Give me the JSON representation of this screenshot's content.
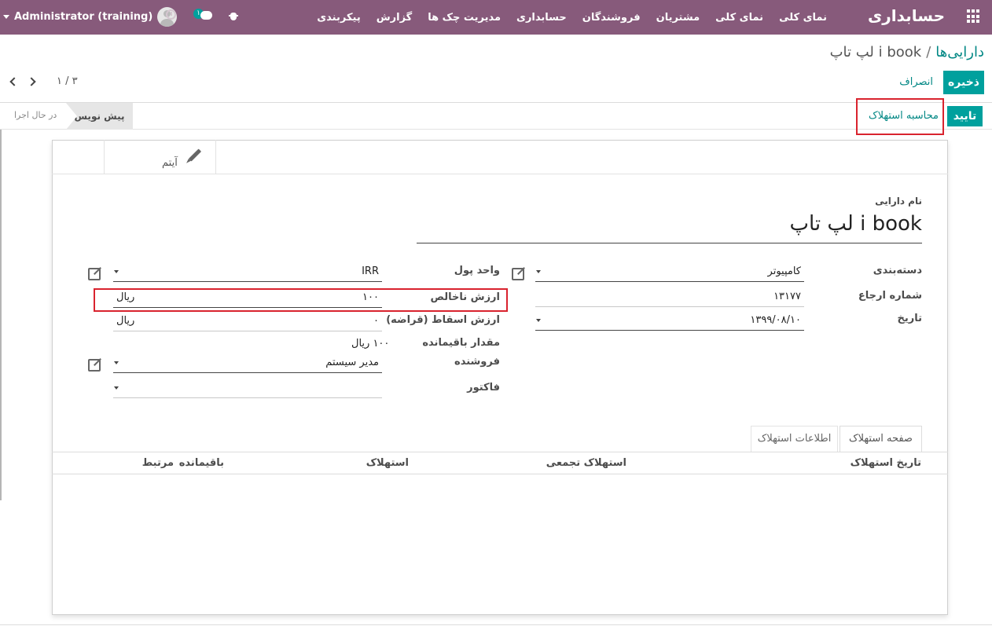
{
  "navbar": {
    "brand": "حسابداری",
    "menu": [
      "نمای کلی",
      "نمای کلی",
      "مشتریان",
      "فروشندگان",
      "حسابداری",
      "مدیریت چک ها",
      "گزارش",
      "پیکربندی"
    ],
    "user": "Administrator (training)",
    "chat_badge": "۱",
    "icons": [
      "apps-grid-icon",
      "clock-icon",
      "chat-icon",
      "bug-icon",
      "user-avatar",
      "chevron-down-icon"
    ]
  },
  "breadcrumb": {
    "parent": "دارایی‌ها",
    "separator": "/",
    "current": "i book لپ تاپ"
  },
  "buttons": {
    "save": "ذخیره",
    "discard": "انصراف",
    "confirm": "تایید",
    "compute": "محاسبه استهلاک"
  },
  "pager": {
    "value": "۱ / ۳"
  },
  "status": {
    "stages": [
      "پیش نویس",
      "در حال اجرا"
    ],
    "active": "پیش نویس"
  },
  "button_box": {
    "items_label": "آیتم"
  },
  "form": {
    "name_label": "نام دارایی",
    "name": "i book لپ تاپ",
    "category_label": "دسته‌بندی",
    "category": "کامپیوتر",
    "reference_label": "شماره ارجاع",
    "reference": "۱۳۱۷۷",
    "date_label": "تاریخ",
    "date": "۱۳۹۹/۰۸/۱۰",
    "currency_label": "واحد پول",
    "currency": "IRR",
    "gross_label": "ارزش ناخالص",
    "gross": "۱۰۰",
    "gross_currency": "ریال",
    "salvage_label": "ارزش اسقاط (قراضه)",
    "salvage": "۰",
    "salvage_currency": "ریال",
    "residual_label": "مقدار باقیمانده",
    "residual": "۱۰۰ ریال",
    "vendor_label": "فروشنده",
    "vendor": "مدیر سیستم",
    "invoice_label": "فاکتور",
    "invoice": ""
  },
  "tabs": [
    "صفحه استهلاک",
    "اطلاعات استهلاک"
  ],
  "table": {
    "headers": [
      "تاریخ استهلاک",
      "استهلاک تجمعی",
      "استهلاک",
      "باقیمانده",
      "مرتبط"
    ]
  },
  "colors": {
    "navbar": "#875a7b",
    "primary": "#00a09d",
    "link": "#008784",
    "highlight": "#d9232e"
  }
}
